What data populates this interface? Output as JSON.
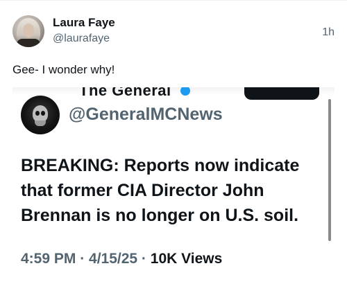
{
  "post": {
    "author_name": "Laura Faye",
    "author_handle": "@laurafaye",
    "timestamp": "1h",
    "text": "Gee- I wonder why!"
  },
  "embedded_screenshot": {
    "cut_off_title": "The General",
    "handle": "@GeneralMCNews",
    "body_lines": [
      "BREAKING: Reports now indicate",
      "that former CIA Director John",
      "Brennan is no longer on U.S. soil."
    ],
    "meta_time": "4:59 PM · 4/15/25 · ",
    "meta_views": "10K Views"
  },
  "colors": {
    "primary_text": "#0f1419",
    "secondary_text": "#536471",
    "verified_badge": "#1d9bf0"
  },
  "icons": [
    "avatar-photo",
    "verified-badge-icon",
    "skull-avatar"
  ]
}
